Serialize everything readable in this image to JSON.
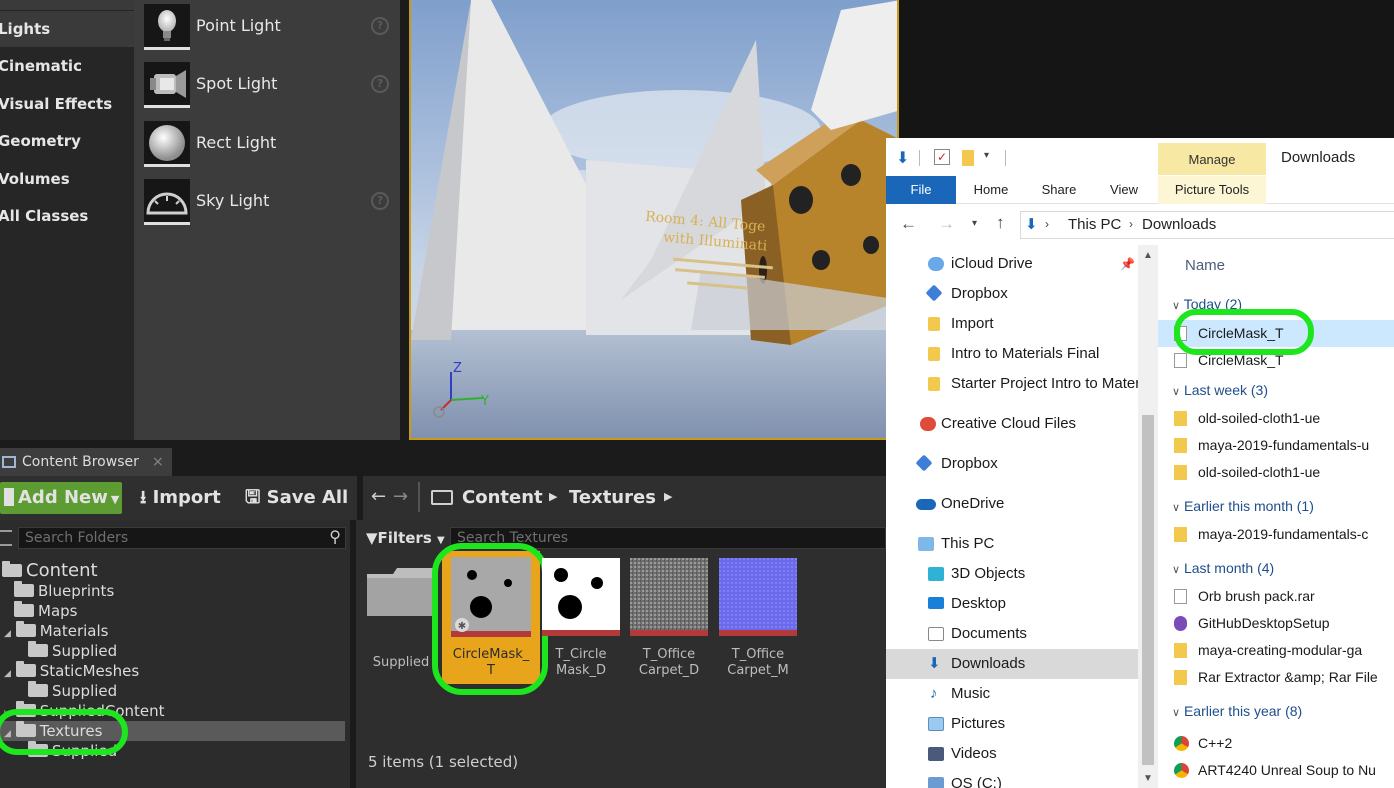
{
  "modes": {
    "categories": [
      "Lights",
      "Cinematic",
      "Visual Effects",
      "Geometry",
      "Volumes",
      "All Classes"
    ],
    "selected_category": "Lights",
    "lights": [
      {
        "label": "Point Light",
        "icon": "point-light-icon"
      },
      {
        "label": "Spot Light",
        "icon": "spot-light-icon"
      },
      {
        "label": "Rect Light",
        "icon": "rect-light-icon"
      },
      {
        "label": "Sky Light",
        "icon": "sky-light-icon"
      }
    ],
    "help_glyph": "?"
  },
  "viewport": {
    "sign_line1": "Room 4: All Toge",
    "sign_line2": "with Illuminati",
    "axis_z": "Z",
    "axis_y": "Y",
    "accent_color": "#c79a1c"
  },
  "content_browser": {
    "tab_label": "Content Browser",
    "close_glyph": "×",
    "toolbar": {
      "add_new": "Add New",
      "import": "Import",
      "save_all": "Save All"
    },
    "breadcrumb": [
      "Content",
      "Textures"
    ],
    "search_folders_placeholder": "Search Folders",
    "filters_label": "Filters",
    "search_textures_placeholder": "Search Textures",
    "tree": {
      "root": "Content",
      "items": [
        "Blueprints",
        "Maps",
        "Materials",
        "Supplied",
        "StaticMeshes",
        "Supplied",
        "SuppliedContent",
        "Textures",
        "Supplied"
      ]
    },
    "assets": [
      {
        "name": "Supplied",
        "type": "folder"
      },
      {
        "name": "CircleMask_T",
        "type": "texture",
        "selected": true
      },
      {
        "name": "T_CircleMask_D",
        "type": "texture"
      },
      {
        "name": "T_OfficeCarpet_D",
        "type": "texture"
      },
      {
        "name": "T_OfficeCarpet_M",
        "type": "texture"
      }
    ],
    "asset_labels": [
      "Supplied",
      "CircleMask_\nT",
      "T_Circle\nMask_D",
      "T_Office\nCarpet_D",
      "T_Office\nCarpet_M"
    ],
    "status": "5 items (1 selected)",
    "colors": {
      "add_new_green": "#5d9b33",
      "selection_orange": "#e8a51c",
      "highlight_green": "#1ee61e"
    }
  },
  "explorer": {
    "window_title": "Downloads",
    "contextual_tab": "Manage",
    "ribbon_tabs": [
      "File",
      "Home",
      "Share",
      "View",
      "Picture Tools"
    ],
    "address": [
      "This PC",
      "Downloads"
    ],
    "column_name": "Name",
    "nav": [
      {
        "label": "iCloud Drive",
        "icon": "icloud-icon"
      },
      {
        "label": "Dropbox",
        "icon": "dropbox-icon"
      },
      {
        "label": "Import",
        "icon": "folder-icon"
      },
      {
        "label": "Intro to Materials Final",
        "icon": "folder-icon"
      },
      {
        "label": "Starter Project Intro to Mater",
        "icon": "folder-icon"
      },
      {
        "label": "Creative Cloud Files",
        "icon": "creative-cloud-icon"
      },
      {
        "label": "Dropbox",
        "icon": "dropbox-icon"
      },
      {
        "label": "OneDrive",
        "icon": "onedrive-icon"
      },
      {
        "label": "This PC",
        "icon": "pc-icon"
      },
      {
        "label": "3D Objects",
        "icon": "3d-objects-icon"
      },
      {
        "label": "Desktop",
        "icon": "desktop-icon"
      },
      {
        "label": "Documents",
        "icon": "documents-icon"
      },
      {
        "label": "Downloads",
        "icon": "downloads-icon",
        "selected": true
      },
      {
        "label": "Music",
        "icon": "music-icon"
      },
      {
        "label": "Pictures",
        "icon": "pictures-icon"
      },
      {
        "label": "Videos",
        "icon": "videos-icon"
      },
      {
        "label": "OS (C:)",
        "icon": "drive-icon"
      }
    ],
    "groups": [
      {
        "header": "Today (2)",
        "files": [
          "CircleMask_T",
          "CircleMask_T"
        ]
      },
      {
        "header": "Last week (3)",
        "files": [
          "old-soiled-cloth1-ue",
          "maya-2019-fundamentals-u",
          "old-soiled-cloth1-ue"
        ]
      },
      {
        "header": "Earlier this month (1)",
        "files": [
          "maya-2019-fundamentals-c"
        ]
      },
      {
        "header": "Last month (4)",
        "files": [
          "Orb brush pack.rar",
          "GitHubDesktopSetup",
          "maya-creating-modular-ga",
          "Rar Extractor &amp; Rar File"
        ]
      },
      {
        "header": "Earlier this year (8)",
        "files": [
          "C++2",
          "ART4240 Unreal Soup to Nu"
        ]
      }
    ]
  }
}
